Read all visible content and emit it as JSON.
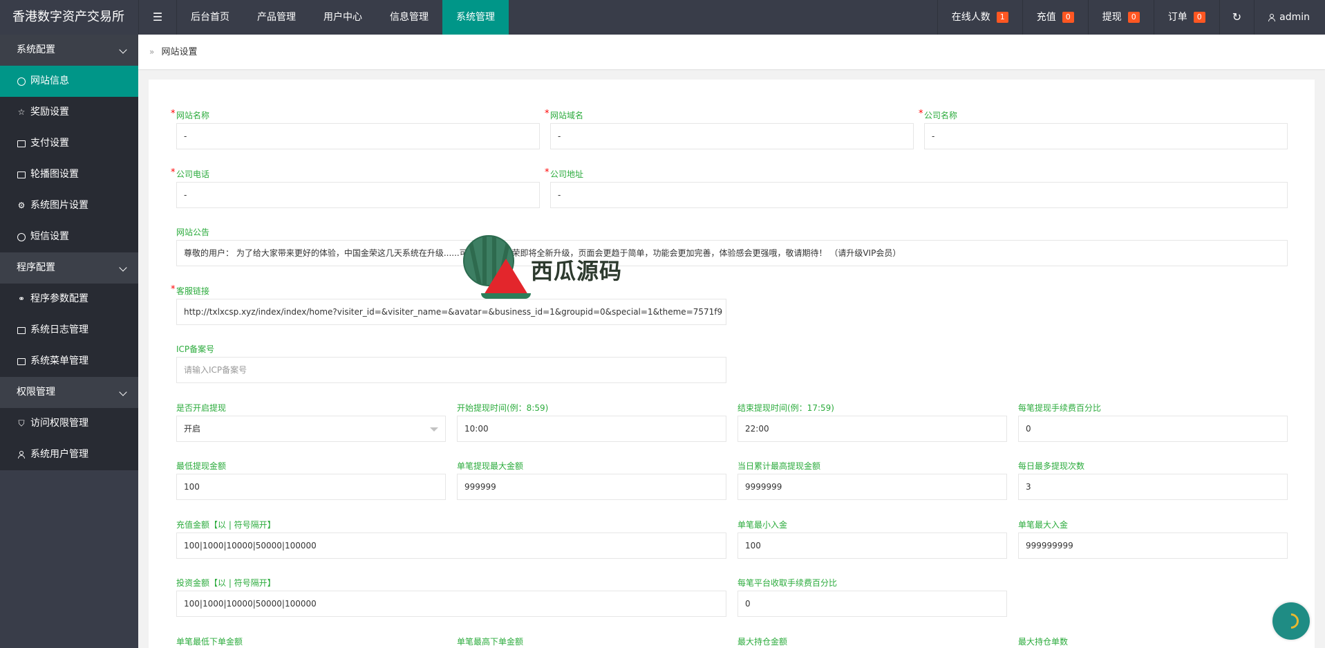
{
  "header": {
    "logo": "香港数字资产交易所",
    "menu_toggle": "☰",
    "nav": [
      "后台首页",
      "产品管理",
      "用户中心",
      "信息管理",
      "系统管理"
    ],
    "active_nav": "系统管理",
    "online_label": "在线人数",
    "online_count": "1",
    "recharge_label": "充值",
    "recharge_count": "0",
    "withdraw_label": "提现",
    "withdraw_count": "0",
    "order_label": "订单",
    "order_count": "0",
    "refresh_icon": "↻",
    "user": "admin",
    "badge_color": "#ff5722",
    "accent_color": "#009688"
  },
  "sidebar": {
    "group1": "系统配置",
    "group1_items": [
      "网站信息",
      "奖励设置",
      "支付设置",
      "轮播图设置",
      "系统图片设置",
      "短信设置"
    ],
    "group2": "程序配置",
    "group2_items": [
      "程序参数配置",
      "系统日志管理",
      "系统菜单管理"
    ],
    "group3": "权限管理",
    "group3_items": [
      "访问权限管理",
      "系统用户管理"
    ],
    "icons": {
      "网站信息": "dashboard-icon",
      "奖励设置": "star-icon",
      "支付设置": "money-icon",
      "轮播图设置": "picture-icon",
      "系统图片设置": "gear-icon",
      "短信设置": "message-icon",
      "程序参数配置": "link-icon",
      "系统日志管理": "clipboard-icon",
      "系统菜单管理": "window-icon",
      "访问权限管理": "shield-icon",
      "系统用户管理": "user-icon"
    }
  },
  "breadcrumb": {
    "separator": "»",
    "current": "网站设置"
  },
  "form": {
    "site_name_label": "网站名称",
    "site_name_value": "-",
    "site_domain_label": "网站域名",
    "site_domain_value": "-",
    "company_name_label": "公司名称",
    "company_name_value": "-",
    "company_phone_label": "公司电话",
    "company_phone_value": "-",
    "company_address_label": "公司地址",
    "company_address_value": "-",
    "notice_label": "网站公告",
    "notice_value": "尊敬的用户： 为了给大家带来更好的体验，中国金荣这几天系统在升级......可 来不便，金荣即将全新升级，页面会更趋于简单，功能会更加完善，体验感会更强哦，敬请期待！ （请升级VIP会员）",
    "service_link_label": "客服链接",
    "service_link_value": "http://txlxcsp.xyz/index/index/home?visiter_id=&visiter_name=&avatar=&business_id=1&groupid=0&special=1&theme=7571f9",
    "icp_label": "ICP备案号",
    "icp_placeholder": "请输入ICP备案号",
    "withdraw_enable_label": "是否开启提现",
    "withdraw_enable_value": "开启",
    "withdraw_start_label": "开始提现时间(例：8:59)",
    "withdraw_start_value": "10:00",
    "withdraw_end_label": "结束提现时间(例：17:59)",
    "withdraw_end_value": "22:00",
    "withdraw_fee_label": "每笔提现手续费百分比",
    "withdraw_fee_value": "0",
    "min_withdraw_label": "最低提现金额",
    "min_withdraw_value": "100",
    "max_withdraw_label": "单笔提现最大金额",
    "max_withdraw_value": "999999",
    "daily_max_label": "当日累计最高提现金额",
    "daily_max_value": "9999999",
    "daily_times_label": "每日最多提现次数",
    "daily_times_value": "3",
    "recharge_amounts_label": "充值金额【以 | 符号隔开】",
    "recharge_amounts_value": "100|1000|10000|50000|100000",
    "min_deposit_label": "单笔最小入金",
    "min_deposit_value": "100",
    "max_deposit_label": "单笔最大入金",
    "max_deposit_value": "999999999",
    "invest_amounts_label": "投资金额【以 | 符号隔开】",
    "invest_amounts_value": "100|1000|10000|50000|100000",
    "platform_fee_label": "每笔平台收取手续费百分比",
    "platform_fee_value": "0",
    "min_order_label": "单笔最低下单金额",
    "max_order_label": "单笔最高下单金额",
    "max_hold_amount_label": "最大持仓金额",
    "max_hold_count_label": "最大持仓单数"
  },
  "watermark": {
    "text": "西瓜源码"
  }
}
